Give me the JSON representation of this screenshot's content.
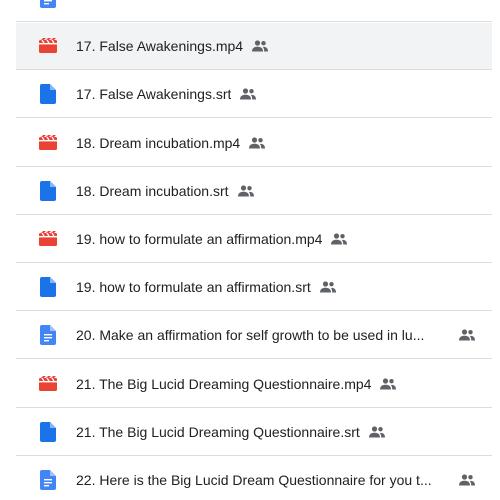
{
  "colors": {
    "video_icon": "#ea4335",
    "subtitle_icon": "#1a73e8",
    "doc_icon": "#4285f4",
    "shared_icon": "#5f6368",
    "text": "#202124",
    "divider": "#dadce0",
    "selected_row": "#f1f3f4"
  },
  "files": [
    {
      "name": "",
      "type": "doc",
      "icon": "file-icon",
      "shared": false
    },
    {
      "name": "17. False Awakenings.mp4",
      "type": "video",
      "icon": "video-file-icon",
      "shared": true,
      "selected": true
    },
    {
      "name": "17. False Awakenings.srt",
      "type": "file",
      "icon": "file-icon",
      "shared": true
    },
    {
      "name": "18. Dream incubation.mp4",
      "type": "video",
      "icon": "video-file-icon",
      "shared": true
    },
    {
      "name": "18. Dream incubation.srt",
      "type": "file",
      "icon": "file-icon",
      "shared": true
    },
    {
      "name": "19. how to formulate an affirmation.mp4",
      "type": "video",
      "icon": "video-file-icon",
      "shared": true
    },
    {
      "name": "19. how to formulate an affirmation.srt",
      "type": "file",
      "icon": "file-icon",
      "shared": true
    },
    {
      "name": "20. Make an affirmation for self growth to be used in lu...",
      "type": "doc",
      "icon": "google-doc-icon",
      "shared": true
    },
    {
      "name": "21. The Big Lucid Dreaming Questionnaire.mp4",
      "type": "video",
      "icon": "video-file-icon",
      "shared": true
    },
    {
      "name": "21. The Big Lucid Dreaming Questionnaire.srt",
      "type": "file",
      "icon": "file-icon",
      "shared": true
    },
    {
      "name": "22. Here is  the Big Lucid Dream Questionnaire for you t...",
      "type": "doc",
      "icon": "google-doc-icon",
      "shared": true
    }
  ]
}
